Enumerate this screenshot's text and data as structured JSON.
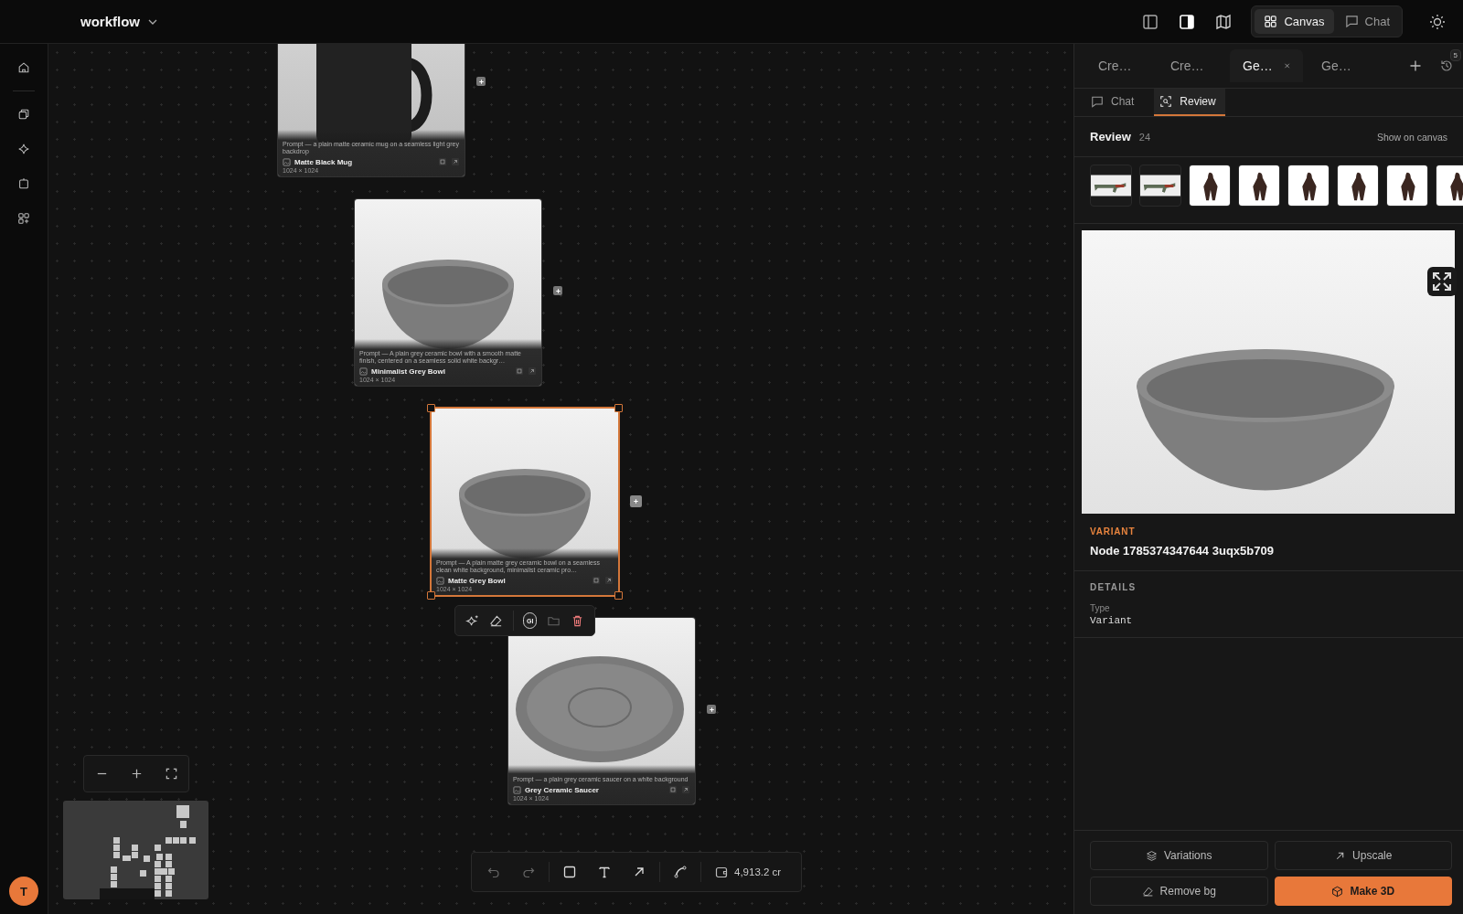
{
  "header": {
    "title": "workflow",
    "views": [
      {
        "label": "Canvas",
        "selected": true
      },
      {
        "label": "Chat",
        "selected": false
      }
    ]
  },
  "canvas": {
    "nodes": [
      {
        "kind": "mug",
        "title": "Matte Black Mug",
        "prompt": "Prompt — a plain matte ceramic mug on a seamless light grey backdrop",
        "size": "1024 × 1024",
        "selected": false
      },
      {
        "kind": "bowl",
        "title": "Minimalist Grey Bowl",
        "prompt": "Prompt — A plain grey ceramic bowl with a smooth matte finish, centered on a seamless solid white backgr…",
        "size": "1024 × 1024",
        "selected": false
      },
      {
        "kind": "bowl",
        "title": "Matte Grey Bowl",
        "prompt": "Prompt — A plain matte grey ceramic bowl on a seamless clean white background, minimalist ceramic pro…",
        "size": "1024 × 1024",
        "selected": true
      },
      {
        "kind": "saucer",
        "title": "Grey Ceramic Saucer",
        "prompt": "Prompt — a plain grey ceramic saucer on a white background",
        "size": "1024 × 1024",
        "selected": false
      }
    ],
    "selection_toolbar": {
      "badge": "GI"
    },
    "credits": "4,913.2 cr"
  },
  "user": {
    "initial": "T"
  },
  "panel": {
    "tabs": [
      {
        "label": "Cre…",
        "selected": false
      },
      {
        "label": "Cre…",
        "selected": false
      },
      {
        "label": "Ge…",
        "selected": true
      },
      {
        "label": "Ge…",
        "selected": false
      }
    ],
    "history_count": "5",
    "subtabs": [
      {
        "label": "Chat",
        "kind": "chat",
        "selected": false
      },
      {
        "label": "Review",
        "kind": "review",
        "selected": true
      }
    ],
    "review": {
      "title": "Review",
      "count": "24",
      "link": "Show on canvas"
    },
    "variant": {
      "kicker": "VARIANT",
      "title": "Node 1785374347644 3uqx5b709"
    },
    "details": {
      "heading": "DETAILS",
      "fields": [
        {
          "label": "Type",
          "value": "Variant"
        }
      ]
    },
    "actions": [
      {
        "label": "Variations",
        "kind": "variations",
        "primary": false
      },
      {
        "label": "Upscale",
        "kind": "upscale",
        "primary": false
      },
      {
        "label": "Remove bg",
        "kind": "remove-bg",
        "primary": false
      },
      {
        "label": "Make 3D",
        "kind": "make-3d",
        "primary": true
      }
    ]
  }
}
